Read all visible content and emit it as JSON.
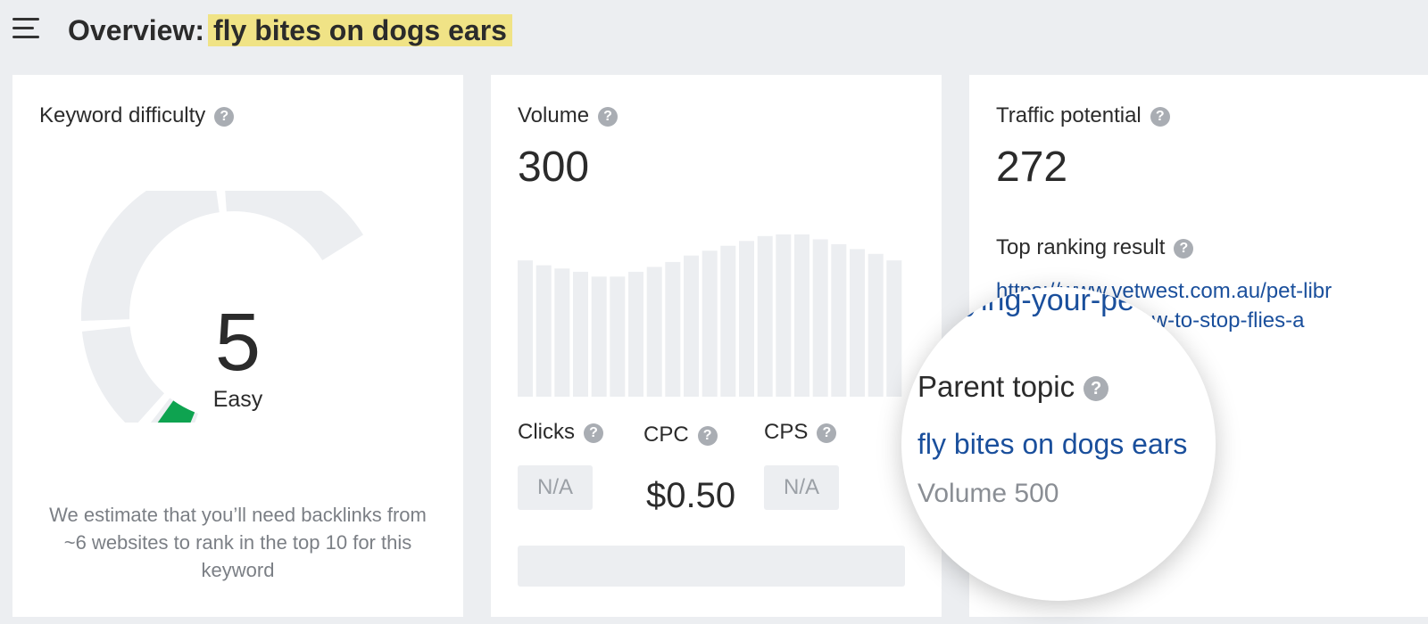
{
  "header": {
    "title_prefix": "Overview:",
    "keyword": "fly bites on dogs ears"
  },
  "keyword_difficulty": {
    "label": "Keyword difficulty",
    "value": "5",
    "rating": "Easy",
    "gauge_fill": 0.05,
    "gauge_color": "#0ea350",
    "description": "We estimate that you’ll need backlinks from ~6 websites to rank in the top 10 for this keyword"
  },
  "volume": {
    "label": "Volume",
    "value": "300",
    "trend_relative": [
      0.84,
      0.81,
      0.79,
      0.77,
      0.74,
      0.74,
      0.77,
      0.8,
      0.83,
      0.87,
      0.9,
      0.93,
      0.96,
      0.99,
      1.0,
      1.0,
      0.97,
      0.94,
      0.91,
      0.88,
      0.84
    ],
    "clicks": {
      "label": "Clicks",
      "value": "N/A"
    },
    "cpc": {
      "label": "CPC",
      "value": "$0.50"
    },
    "cps": {
      "label": "CPS",
      "value": "N/A"
    }
  },
  "traffic": {
    "label": "Traffic potential",
    "value": "272",
    "top_result_label": "Top ranking result",
    "top_result_url_line1": "https://www.vetwest.com.au/pet-libr",
    "top_result_url_line2": "ying-your-pet-how-to-stop-flies-a"
  },
  "parent_topic": {
    "label": "Parent topic",
    "topic": "fly bites on dogs ears",
    "volume_text": "Volume 500",
    "ghost_url_fragment": "ying-your-pe"
  },
  "help_glyph": "?",
  "colors": {
    "background": "#eceef1",
    "card": "#ffffff",
    "highlight": "#f0e386",
    "link": "#1a4f9c",
    "bar": "#eceef1"
  }
}
